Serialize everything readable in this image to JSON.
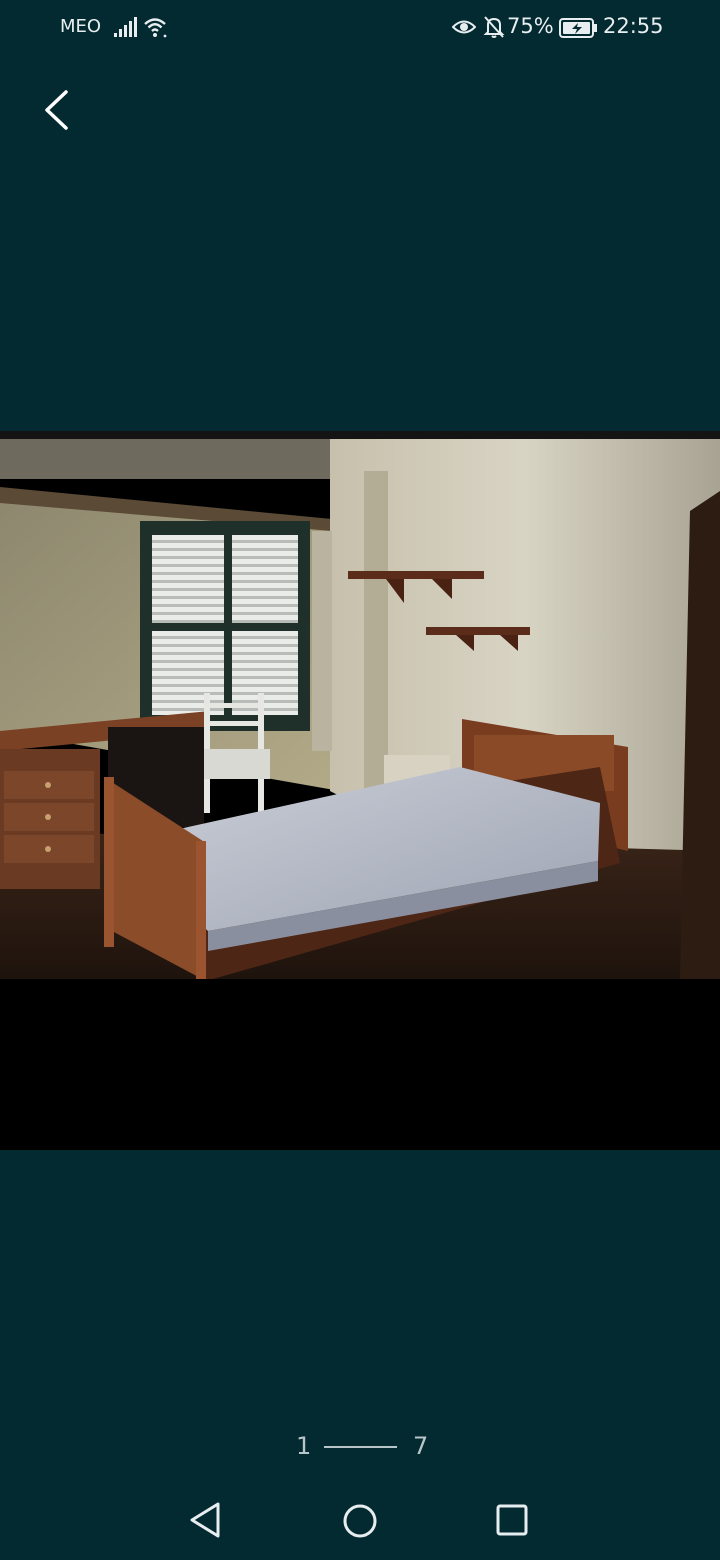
{
  "status_bar": {
    "carrier": "MEO",
    "battery_percent": "75%",
    "time": "22:55",
    "icons": [
      "signal-icon",
      "wifi-icon",
      "eye-icon",
      "bell-off-icon",
      "battery-charging-icon"
    ]
  },
  "toolbar": {
    "back_icon": "chevron-left-icon"
  },
  "gallery": {
    "current_index": "1",
    "total_count": "7",
    "photo_subject": "bedroom photo"
  },
  "nav_bar": {
    "icons": [
      "triangle-back-icon",
      "circle-home-icon",
      "square-recents-icon"
    ]
  },
  "colors": {
    "background": "#022a30",
    "photo_letterbox": "#000000",
    "text": "#e8eef0",
    "pager": "#b8c6c9"
  }
}
